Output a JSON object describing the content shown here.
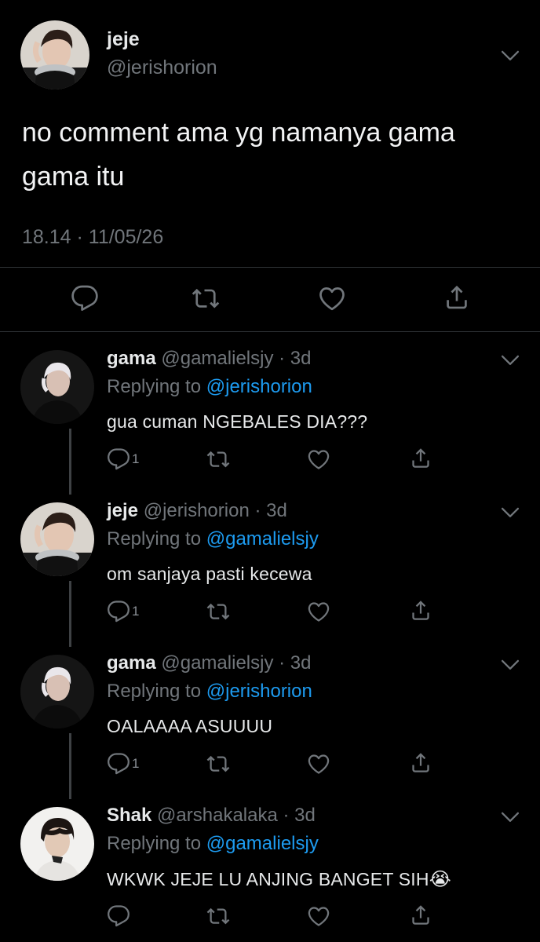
{
  "main_tweet": {
    "display_name": "jeje",
    "handle": "@jerishorion",
    "text_line1": "no comment ama yg namanya gama",
    "text_line2": "gama itu",
    "timestamp": "18.14 · 11/05/26"
  },
  "replies": [
    {
      "display_name": "gama",
      "handle": "@gamalielsjy",
      "age": "· 3d",
      "replying_label": "Replying to",
      "replying_to": "@jerishorion",
      "text": "gua cuman NGEBALES DIA???",
      "reply_count": "1"
    },
    {
      "display_name": "jeje",
      "handle": "@jerishorion",
      "age": "· 3d",
      "replying_label": "Replying to",
      "replying_to": "@gamalielsjy",
      "text": "om sanjaya pasti kecewa",
      "reply_count": "1"
    },
    {
      "display_name": "gama",
      "handle": "@gamalielsjy",
      "age": "· 3d",
      "replying_label": "Replying to",
      "replying_to": "@jerishorion",
      "text": "OALAAAA ASUUUU",
      "reply_count": "1"
    },
    {
      "display_name": "Shak",
      "handle": "@arshakalaka",
      "age": "· 3d",
      "replying_label": "Replying to",
      "replying_to": "@gamalielsjy",
      "text": "WKWK JEJE LU ANJING BANGET SIH",
      "emoji": "😭",
      "reply_count": ""
    }
  ],
  "icons": [
    "reply-icon",
    "retweet-icon",
    "like-icon",
    "share-icon",
    "chevron-down-icon"
  ],
  "colors": {
    "background": "#000000",
    "text": "#e7e9ea",
    "muted": "#71767b",
    "link": "#1d9bf0",
    "divider": "#2f3336"
  }
}
